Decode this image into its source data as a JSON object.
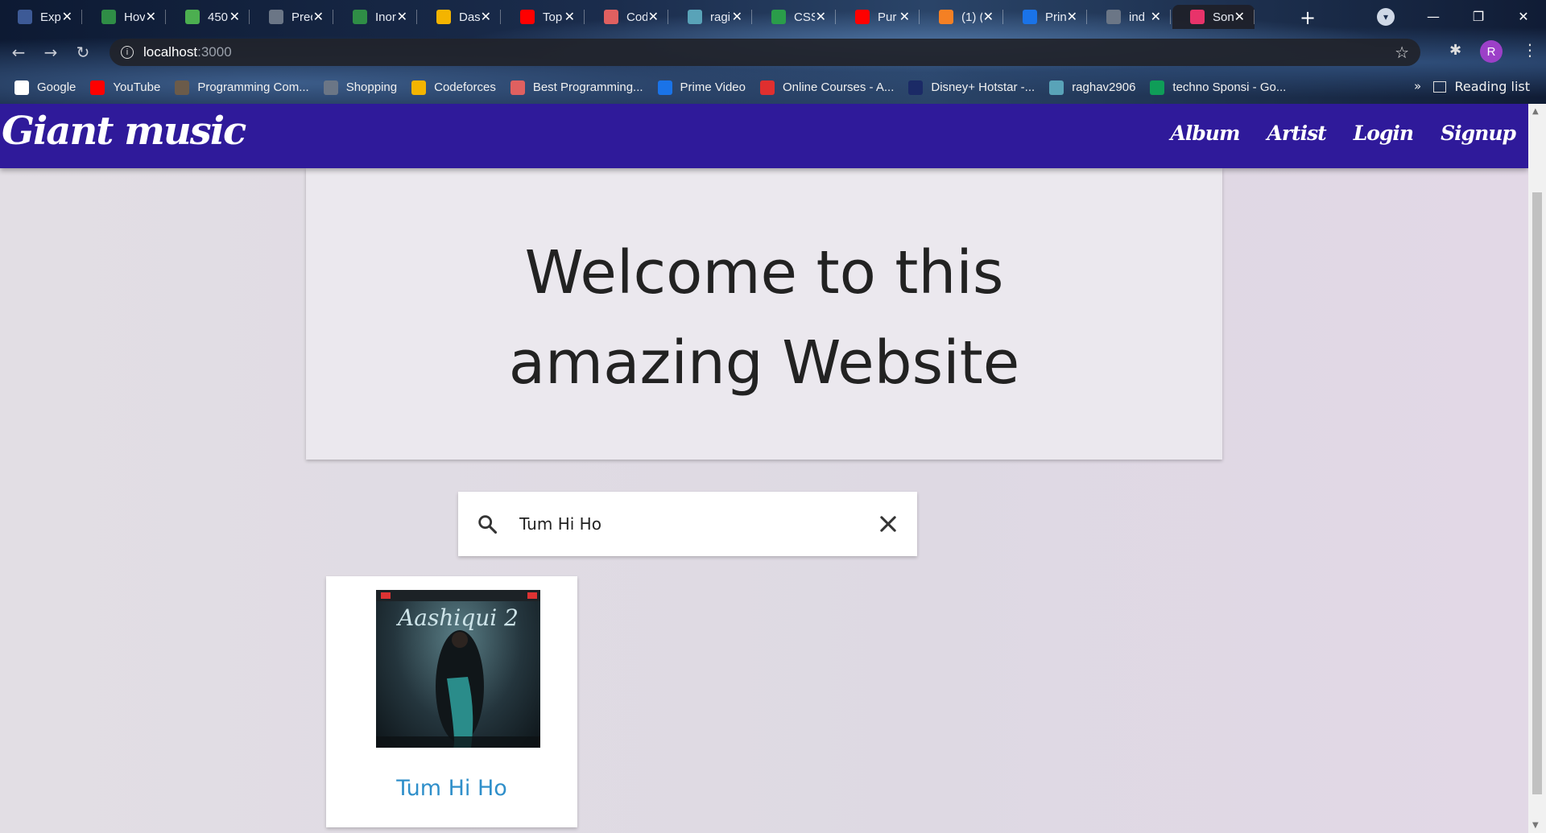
{
  "browser": {
    "tabs": [
      {
        "title": "Exp",
        "icon": "sf-icon",
        "color": "#3d5a96"
      },
      {
        "title": "Hov",
        "icon": "gfg-icon",
        "color": "#2f8d46"
      },
      {
        "title": "450",
        "icon": "four-icon",
        "color": "#4caf50"
      },
      {
        "title": "Prec",
        "icon": "globe-icon",
        "color": "#6b7686"
      },
      {
        "title": "Inor",
        "icon": "gfg-icon",
        "color": "#2f8d46"
      },
      {
        "title": "Das",
        "icon": "bar-chart-icon",
        "color": "#f4b400"
      },
      {
        "title": "Top",
        "icon": "youtube-icon",
        "color": "#ff0000"
      },
      {
        "title": "Cod",
        "icon": "cube-icon",
        "color": "#e06060"
      },
      {
        "title": "ragi",
        "icon": "profile-image-icon",
        "color": "#59a3b8"
      },
      {
        "title": "CSS",
        "icon": "w-icon",
        "color": "#2a9d4a"
      },
      {
        "title": "Pur",
        "icon": "youtube-icon",
        "color": "#ff0000"
      },
      {
        "title": "(1) (",
        "icon": "stack-icon",
        "color": "#f48024"
      },
      {
        "title": "Prin",
        "icon": "play-circle-icon",
        "color": "#1a73e8"
      },
      {
        "title": "ind",
        "icon": "globe-icon",
        "color": "#6b7686"
      },
      {
        "title": "Son",
        "icon": "music-app-icon",
        "color": "#e8336a"
      }
    ],
    "active_tab_index": 14,
    "url_host": "localhost",
    "url_port": ":3000",
    "avatar_letter": "R",
    "bookmarks": [
      {
        "label": "Google",
        "icon": "google-icon",
        "color": "#ffffff"
      },
      {
        "label": "YouTube",
        "icon": "youtube-icon",
        "color": "#ff0000"
      },
      {
        "label": "Programming Com...",
        "icon": "cc-icon",
        "color": "#6b5b4a"
      },
      {
        "label": "Shopping",
        "icon": "globe-icon",
        "color": "#6b7686"
      },
      {
        "label": "Codeforces",
        "icon": "bar-chart-icon",
        "color": "#f4b400"
      },
      {
        "label": "Best Programming...",
        "icon": "cube-icon",
        "color": "#e06060"
      },
      {
        "label": "Prime Video",
        "icon": "play-circle-icon",
        "color": "#1a73e8"
      },
      {
        "label": "Online Courses - A...",
        "icon": "udemy-icon",
        "color": "#e02f2f"
      },
      {
        "label": "Disney+ Hotstar -...",
        "icon": "hotstar-icon",
        "color": "#1b2a66"
      },
      {
        "label": "raghav2906",
        "icon": "profile-image-icon",
        "color": "#59a3b8"
      },
      {
        "label": "techno Sponsi - Go...",
        "icon": "sheets-icon",
        "color": "#0f9d58"
      }
    ],
    "bookmarks_more": "»",
    "reading_list": "Reading list"
  },
  "app": {
    "brand": "Giant music",
    "nav": [
      "Album",
      "Artist",
      "Login",
      "Signup"
    ],
    "hero_title": "Welcome to this amazing Website",
    "search": {
      "value": "Tum Hi Ho",
      "placeholder": ""
    },
    "results": [
      {
        "title": "Tum Hi Ho",
        "cover_text": "Aashiqui 2"
      }
    ],
    "accent": "#2f1a9a",
    "link_color": "#2f8fca"
  }
}
